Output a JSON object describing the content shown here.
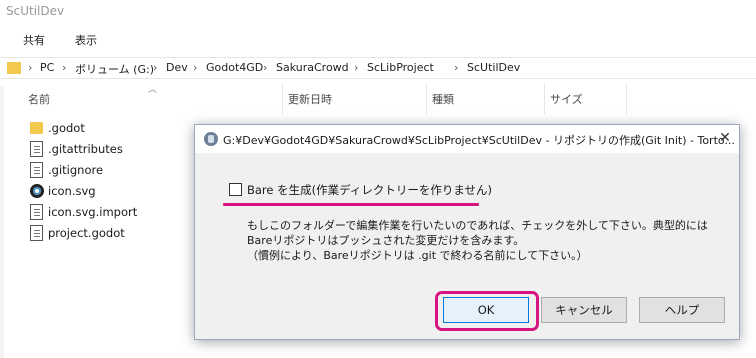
{
  "window": {
    "title": "ScUtilDev"
  },
  "ribbon": {
    "tabs": [
      "共有",
      "表示"
    ]
  },
  "address": {
    "crumbs": [
      "PC",
      "ボリューム (G:)",
      "Dev",
      "Godot4GD",
      "SakuraCrowd",
      "ScLibProject",
      "ScUtilDev"
    ],
    "separator": "›"
  },
  "columns": {
    "name": "名前",
    "date": "更新日時",
    "type": "種類",
    "size": "サイズ"
  },
  "files": [
    {
      "name": ".godot",
      "icon": "folder-icon"
    },
    {
      "name": ".gitattributes",
      "icon": "document-icon"
    },
    {
      "name": ".gitignore",
      "icon": "document-icon"
    },
    {
      "name": "icon.svg",
      "icon": "godot-icon"
    },
    {
      "name": "icon.svg.import",
      "icon": "document-icon"
    },
    {
      "name": "project.godot",
      "icon": "document-icon"
    }
  ],
  "dialog": {
    "title": "G:¥Dev¥Godot4GD¥SakuraCrowd¥ScLibProject¥ScUtilDev - リポジトリの作成(Git Init) - Torto...",
    "close_glyph": "✕",
    "checkbox": {
      "label": "Bare を生成(作業ディレクトリーを作りません)",
      "checked": false
    },
    "description": [
      "もしこのフォルダーで編集作業を行いたいのであれば、チェックを外して下さい。典型的には",
      "Bareリポジトリはプッシュされた変更だけを含みます。",
      "（慣例により、Bareリポジトリは .git で終わる名前にして下さい。）"
    ],
    "buttons": {
      "ok": "OK",
      "cancel": "キャンセル",
      "help": "ヘルプ"
    }
  },
  "colors": {
    "highlight": "#d6157f",
    "ok_border": "#0078d7"
  }
}
